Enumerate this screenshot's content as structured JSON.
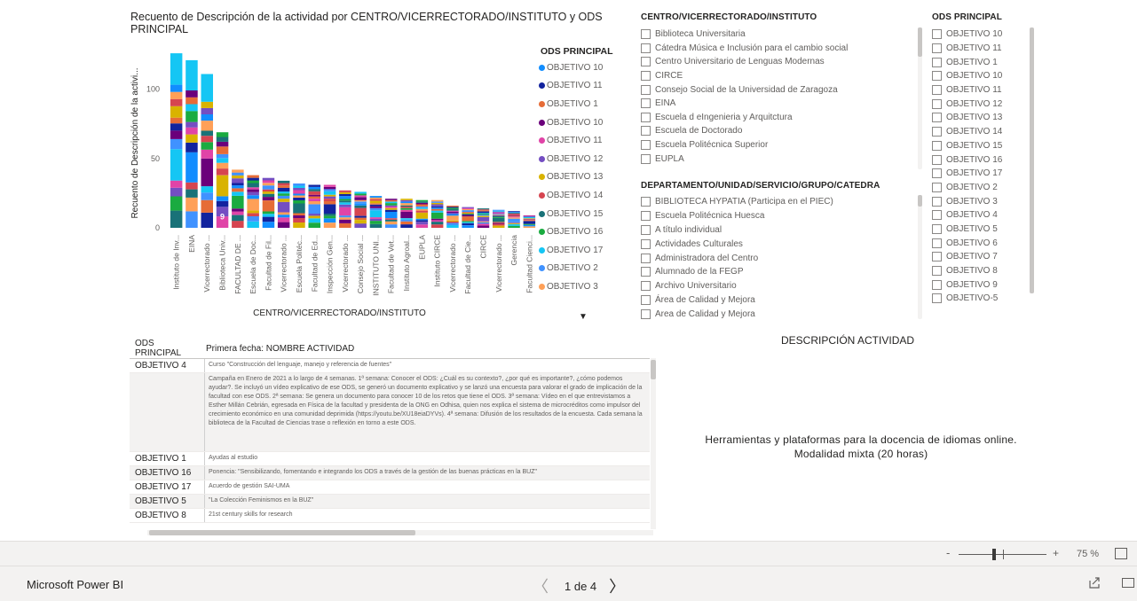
{
  "chart": {
    "title": "Recuento de Descripción de la actividad por CENTRO/VICERRECTORADO/INSTITUTO y ODS PRINCIPAL",
    "legend_title": "ODS PRINCIPAL",
    "legend": [
      {
        "label": "OBJETIVO 10",
        "color": "#118DFF"
      },
      {
        "label": "OBJETIVO 11",
        "color": "#12239E"
      },
      {
        "label": "OBJETIVO 1",
        "color": "#E66C37"
      },
      {
        "label": "OBJETIVO 10",
        "color": "#6B007B"
      },
      {
        "label": "OBJETIVO 11",
        "color": "#E044A7"
      },
      {
        "label": "OBJETIVO 12",
        "color": "#744EC2"
      },
      {
        "label": "OBJETIVO 13",
        "color": "#D9B300"
      },
      {
        "label": "OBJETIVO 14",
        "color": "#D64550"
      },
      {
        "label": "OBJETIVO 15",
        "color": "#197278"
      },
      {
        "label": "OBJETIVO 16",
        "color": "#1AAB40"
      },
      {
        "label": "OBJETIVO 17",
        "color": "#15C6F4"
      },
      {
        "label": "OBJETIVO 2",
        "color": "#4092FF"
      },
      {
        "label": "OBJETIVO 3",
        "color": "#FFA058"
      }
    ],
    "more_icon": "caret-down-icon"
  },
  "chart_data": {
    "type": "bar",
    "stacked": true,
    "title": "Recuento de Descripción de la actividad por CENTRO/VICERRECTORADO/INSTITUTO y ODS PRINCIPAL",
    "xlabel": "CENTRO/VICERRECTORADO/INSTITUTO",
    "ylabel": "Recuento de Descripción de la activi...",
    "ylim": [
      0,
      135
    ],
    "yticks": [
      0,
      50,
      100
    ],
    "categories": [
      "Instituto de Inv...",
      "EINA",
      "Vicerrectorado ...",
      "Biblioteca Univ...",
      "FACULTAD DE ...",
      "Escuela de Doc...",
      "Facultad de Fil...",
      "Vicerrectorado ...",
      "Escuela Politéc...",
      "Facultad de Ed...",
      "Inspección Gen...",
      "Vicerrectorado ...",
      "Consejo Social ...",
      "INSTITUTO UNI...",
      "Facultad de Vet...",
      "Instituto Agroal...",
      "EUPLA",
      "Instituto CIRCE",
      "Vicerrectorado ...",
      "Facultad de Cie...",
      "CIRCE",
      "Vicerrectorado ...",
      "Gerencia",
      "Facultad Cienci..."
    ],
    "totals": [
      126,
      121,
      111,
      69,
      42,
      38,
      36,
      34,
      32,
      31,
      31,
      27,
      26,
      23,
      21,
      21,
      20,
      20,
      16,
      15,
      14,
      13,
      12,
      9
    ],
    "data_labels": [
      {
        "category": "Biblioteca Univ...",
        "text": "9"
      }
    ],
    "grid": false,
    "legend_position": "right"
  },
  "slicer_centro": {
    "title": "CENTRO/VICERRECTORADO/INSTITUTO",
    "items": [
      "Biblioteca Universitaria",
      "Cátedra Música e Inclusión para el cambio social",
      "Centro Universitario de Lenguas Modernas",
      "CIRCE",
      "Consejo Social de la Universidad de Zaragoza",
      "EINA",
      "Escuela d eIngenieria y Arquitctura",
      "Escuela de Doctorado",
      "Escuela Politécnica Superior",
      "EUPLA"
    ]
  },
  "slicer_depto": {
    "title": "DEPARTAMENTO/UNIDAD/SERVICIO/GRUPO/CATEDRA",
    "items": [
      "BIBLIOTECA HYPATIA (Participa en el PIEC)",
      "Escuela Politécnica Huesca",
      "A título individual",
      "Actividades Culturales",
      "Administradora del Centro",
      "Alumnado de la FEGP",
      "Archivo Universitario",
      "Área de Calidad y Mejora",
      "Area de Calidad y Mejora"
    ]
  },
  "slicer_ods": {
    "title": "ODS PRINCIPAL",
    "items": [
      "OBJETIVO 10",
      "OBJETIVO 11",
      "OBJETIVO 1",
      "OBJETIVO 10",
      "OBJETIVO 11",
      "OBJETIVO 12",
      "OBJETIVO 13",
      "OBJETIVO 14",
      "OBJETIVO 15",
      "OBJETIVO 16",
      "OBJETIVO 17",
      "OBJETIVO 2",
      "OBJETIVO 3",
      "OBJETIVO 4",
      "OBJETIVO 5",
      "OBJETIVO 6",
      "OBJETIVO 7",
      "OBJETIVO 8",
      "OBJETIVO 9",
      "OBJETIVO-5"
    ]
  },
  "table": {
    "col1": "ODS PRINCIPAL",
    "col2": "Primera fecha: NOMBRE ACTIVIDAD",
    "rows": [
      {
        "ods": "OBJETIVO 4",
        "act": "Curso \"Construcción del lenguaje, manejo y referencia de fuentes\""
      },
      {
        "ods": "",
        "act": "Campaña en Enero de 2021 a lo largo de 4 semanas. 1ª semana: Conocer el ODS: ¿Cuál es su contexto?, ¿por qué es importante?, ¿cómo podemos ayudar?. Se incluyó un vídeo explicativo de ese ODS, se generó un documento explicativo y se lanzó una encuesta para valorar el grado de implicación de la facultad con ese ODS. 2ª semana: Se genera un documento para conocer 10 de los retos que tiene el ODS. 3ª semana: Vídeo en el que entrevistamos a Esther Millán Cebrián, egresada en Física de la facultad y presidenta de la ONG en Odhisa, quien nos explica el sistema de microcréditos como impulsor del crecimiento económico en una comunidad deprimida (https://youtu.be/XU18eiaDYVs). 4ª semana: Difusión de los resultados de la encuesta. Cada semana la biblioteca de la Facultad de Ciencias trase o reflexión en torno a este ODS."
      },
      {
        "ods": "OBJETIVO 1",
        "act": "Ayudas al estudio"
      },
      {
        "ods": "OBJETIVO 16",
        "act": "Ponencia: \"Sensibilizando, fomentando e integrando los ODS a través de la gestión de las buenas prácticas en la BUZ\""
      },
      {
        "ods": "OBJETIVO 17",
        "act": "Acuerdo de gestión SAI-UMA"
      },
      {
        "ods": "OBJETIVO 5",
        "act": "\"La Colección Feminismos en la BUZ\""
      },
      {
        "ods": "OBJETIVO 8",
        "act": "21st century skills for research"
      }
    ]
  },
  "card": {
    "title": "DESCRIPCIÓN ACTIVIDAD",
    "value": "Herramientas y plataformas para la docencia de idiomas online. Modalidad mixta (20 horas)"
  },
  "zoom": {
    "minus": "-",
    "plus": "+",
    "percent": "75 %",
    "level": 0.5
  },
  "footer": {
    "brand": "Microsoft Power BI",
    "page_text": "1 de 4",
    "prev": "〈",
    "next": "〉"
  }
}
